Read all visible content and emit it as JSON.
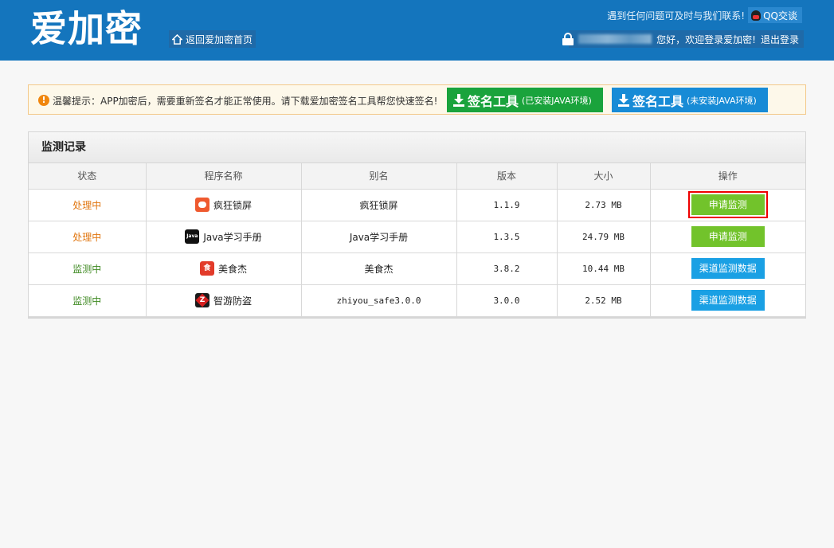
{
  "header": {
    "logo": "爱加密",
    "home_link": "返回爱加密首页",
    "help_text": "遇到任何问题可及时与我们联系!",
    "qq_label": "QQ交谈",
    "welcome": "您好，欢迎登录爱加密!",
    "logout": "退出登录"
  },
  "notice": {
    "text": "温馨提示：APP加密后，需要重新签名才能正常使用。请下载爱加密签名工具帮您快速签名!",
    "btn_java_main": "签名工具",
    "btn_java_sub": "(已安装JAVA环境)",
    "btn_nojava_main": "签名工具",
    "btn_nojava_sub": "(未安装JAVA环境)"
  },
  "panel": {
    "title": "监测记录",
    "columns": [
      "状态",
      "程序名称",
      "别名",
      "版本",
      "大小",
      "操作"
    ],
    "rows": [
      {
        "status": "处理中",
        "name": "疯狂锁屏",
        "alias": "疯狂锁屏",
        "version": "1.1.9",
        "size": "2.73 MB",
        "action": "申请监测",
        "icon": "pig-icon"
      },
      {
        "status": "处理中",
        "name": "Java学习手册",
        "alias": "Java学习手册",
        "version": "1.3.5",
        "size": "24.79 MB",
        "action": "申请监测",
        "icon": "java-icon"
      },
      {
        "status": "监测中",
        "name": "美食杰",
        "alias": "美食杰",
        "version": "3.8.2",
        "size": "10.44 MB",
        "action": "渠道监测数据",
        "icon": "food-icon"
      },
      {
        "status": "监测中",
        "name": "智游防盗",
        "alias": "zhiyou_safe3.0.0",
        "version": "3.0.0",
        "size": "2.52 MB",
        "action": "渠道监测数据",
        "icon": "zhiyou-icon"
      }
    ]
  },
  "colors": {
    "header_bg": "#1475bd",
    "status_processing": "#e0750e",
    "status_monitoring": "#3f8a22",
    "btn_green": "#72c32b",
    "btn_blue": "#1aa0e4",
    "highlight": "#e00000"
  }
}
